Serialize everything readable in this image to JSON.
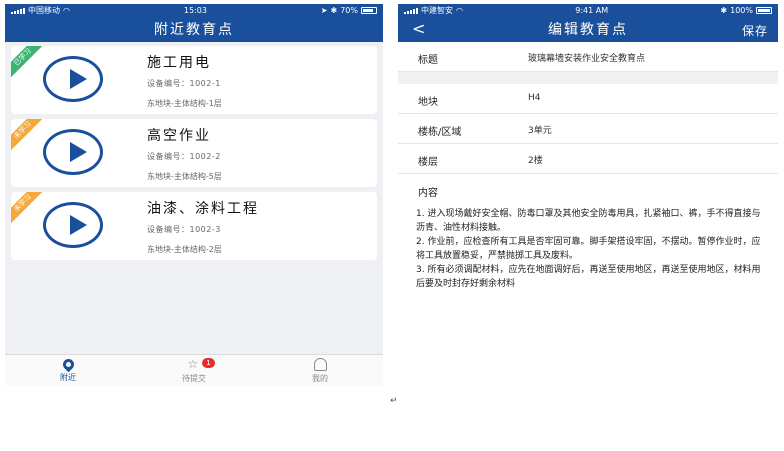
{
  "left": {
    "status": {
      "carrier": "中国移动",
      "time": "15:03",
      "battery": "70%"
    },
    "title": "附近教育点",
    "cards": [
      {
        "badge": "已学习",
        "badge_color": "#3cb371",
        "title": "施工用电",
        "device": "设备编号：1002-1",
        "location": "东地块-主体结构-1层"
      },
      {
        "badge": "未学习",
        "badge_color": "#f4a93a",
        "title": "高空作业",
        "device": "设备编号：1002-2",
        "location": "东地块-主体结构-5层"
      },
      {
        "badge": "未学习",
        "badge_color": "#f4a93a",
        "title": "油漆、涂料工程",
        "device": "设备编号：1002-3",
        "location": "东地块-主体结构-2层"
      }
    ],
    "tabs": [
      {
        "label": "附近",
        "icon": "location-pin-icon",
        "active": true
      },
      {
        "label": "待提交",
        "icon": "star-icon",
        "badge": "1"
      },
      {
        "label": "我的",
        "icon": "user-icon"
      }
    ]
  },
  "right": {
    "status": {
      "carrier": "中建智安",
      "time": "9:41 AM",
      "battery": "100%"
    },
    "title": "编辑教育点",
    "back": "<",
    "save": "保存",
    "fields": [
      {
        "label": "标题",
        "value": "玻璃幕墙安装作业安全教育点"
      },
      {
        "label": "地块",
        "value": "H4"
      },
      {
        "label": "楼栋/区域",
        "value": "3单元"
      },
      {
        "label": "楼层",
        "value": "2楼"
      }
    ],
    "content_label": "内容",
    "content_text": "1. 进入现场戴好安全帽、防毒口罩及其他安全防毒用具，扎紧袖口、裤，手不得直接与沥青、油性材料接触。\n2. 作业前，应检查所有工具是否牢固可靠。脚手架搭设牢固，不摆动。暂停作业时，应将工具放置稳妥，严禁抛掷工具及废料。\n3. 所有必须调配材料，应先在地面调好后，再送至使用地区，再送至使用地区，材料用后要及时封存好剩余材料"
  },
  "return_mark": "↵"
}
